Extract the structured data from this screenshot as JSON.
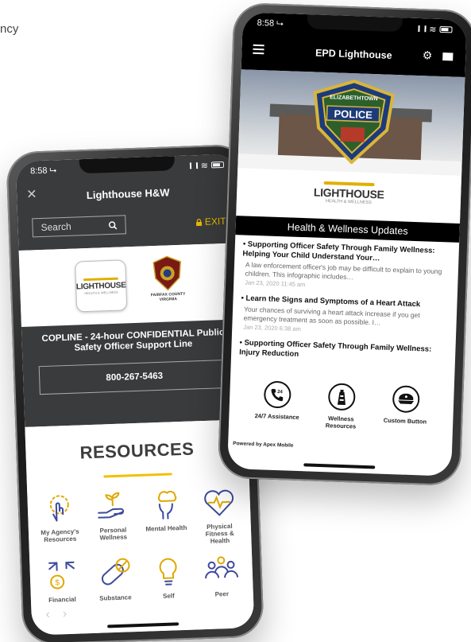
{
  "background": {
    "fragment_text": "ncy"
  },
  "left_phone": {
    "status": {
      "time": "8:58 ⮡"
    },
    "nav": {
      "title": "Lighthouse H&W",
      "close_icon": "close-icon"
    },
    "search": {
      "placeholder": "Search",
      "icon": "search-icon"
    },
    "exit": {
      "label": "EXIT",
      "icon": "lock-icon"
    },
    "logos": {
      "lighthouse": {
        "word": "LIGHTHOUSE",
        "sub": "HEALTH & WELLNESS"
      },
      "fairfax": {
        "top": "POLICE",
        "bottom": "FAIRFAX COUNTY VIRGINIA"
      }
    },
    "copline": {
      "text": "COPLINE - 24-hour CONFIDENTIAL Public Safety Officer Support Line",
      "phone": "800-267-5463"
    },
    "resources": {
      "title": "RESOURCES",
      "items": [
        {
          "label": "My Agency's Resources",
          "icon": "gear-hand-icon"
        },
        {
          "label": "Personal Wellness",
          "icon": "hand-sprout-icon"
        },
        {
          "label": "Mental Health",
          "icon": "head-cloud-icon"
        },
        {
          "label": "Physical Fitness & Health",
          "icon": "heartbeat-icon"
        },
        {
          "label": "Financial",
          "icon": "dollar-arrows-icon"
        },
        {
          "label": "Substance",
          "icon": "pill-icon"
        },
        {
          "label": "Self",
          "icon": "lightbulb-icon"
        },
        {
          "label": "Peer",
          "icon": "people-icon"
        }
      ]
    },
    "bottom_nav": {
      "back": "‹",
      "forward": "›"
    }
  },
  "right_phone": {
    "status": {
      "time": "8:58 ⮡"
    },
    "nav": {
      "title": "EPD Lighthouse"
    },
    "hero": {
      "badge_top": "ELIZABETHTOWN",
      "badge_mid": "POLICE"
    },
    "logo": {
      "word": "LIGHTHOUSE",
      "sub": "HEALTH & WELLNESS"
    },
    "updates_header": "Health & Wellness Updates",
    "news": [
      {
        "title": "Supporting Officer Safety Through Family Wellness: Helping Your Child Understand Your…",
        "body": "A law enforcement officer's job may be difficult to explain to young children. This infographic includes…",
        "date": "Jan 23, 2020 11:45 am"
      },
      {
        "title": "Learn the Signs and Symptoms of a Heart Attack",
        "body": "Your chances of surviving a heart attack increase if you get emergency treatment as soon as possible. I…",
        "date": "Jan 23, 2020 6:38 am"
      },
      {
        "title": "Supporting Officer Safety Through Family Wellness: Injury Reduction",
        "body": "",
        "date": ""
      }
    ],
    "actions": [
      {
        "label": "24/7 Assistance",
        "icon": "phone-24-icon"
      },
      {
        "label": "Wellness Resources",
        "icon": "lighthouse-icon"
      },
      {
        "label": "Custom Button",
        "icon": "police-cap-icon"
      }
    ],
    "powered_by": "Powered by Apex Mobile"
  },
  "colors": {
    "dark_header": "#3a3b3c",
    "accent_gold": "#f0c000",
    "icon_blue": "#3d4a9c",
    "black": "#000000"
  }
}
